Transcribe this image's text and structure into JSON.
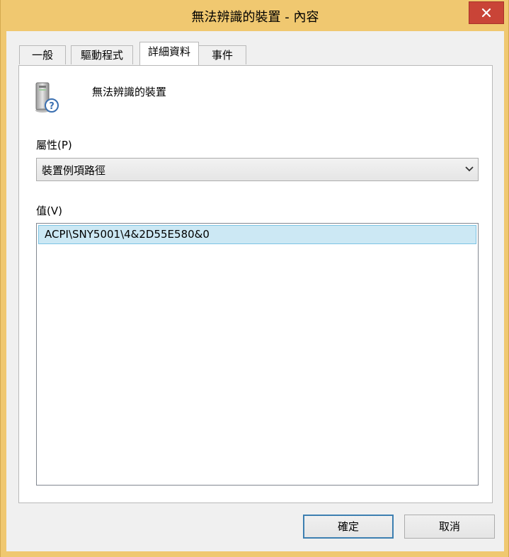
{
  "window": {
    "title": "無法辨識的裝置 - 內容"
  },
  "tabs": [
    {
      "label": "一般"
    },
    {
      "label": "驅動程式"
    },
    {
      "label": "詳細資料"
    },
    {
      "label": "事件"
    }
  ],
  "device": {
    "name": "無法辨識的裝置",
    "icon": "unknown-device-icon"
  },
  "property": {
    "label": "屬性(P)",
    "selected": "裝置例項路徑"
  },
  "value": {
    "label": "值(V)",
    "items": [
      "ACPI\\SNY5001\\4&2D55E580&0"
    ]
  },
  "buttons": {
    "ok": "確定",
    "cancel": "取消"
  },
  "colors": {
    "titlebar": "#f0c870",
    "close": "#c94437",
    "selection": "#cce8f4"
  }
}
